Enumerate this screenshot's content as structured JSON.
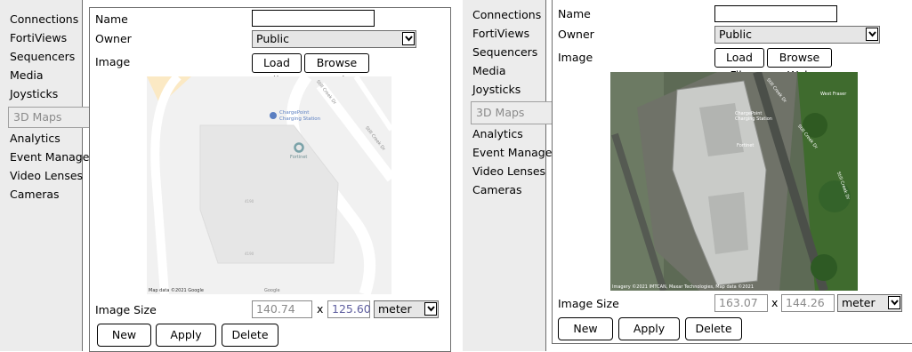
{
  "colors": {
    "sidebar_bg": "#ececec",
    "border": "#6e6e6e",
    "poi": "#5b7fc2",
    "map_bg": "#f4f4f4",
    "sat_bg": "#5f6b57"
  },
  "sidebar": {
    "items": [
      "Connections",
      "FortiViews",
      "Sequencers",
      "Media",
      "Joysticks",
      "3D Maps",
      "Analytics",
      "Event Manager",
      "Video Lenses",
      "Cameras"
    ],
    "active": "3D Maps"
  },
  "form": {
    "name_label": "Name",
    "name_value": "",
    "owner_label": "Owner",
    "owner_value": "Public",
    "image_label": "Image",
    "load_file": "Load File",
    "browse_web": "Browse Web",
    "image_size_label": "Image Size",
    "times": "x",
    "unit": "meter",
    "new": "New",
    "apply": "Apply",
    "delete": "Delete"
  },
  "left": {
    "width_value": "140.74",
    "height_value": "125.60",
    "map": {
      "poi_label_1": "ChargePoint",
      "poi_label_2": "Charging Station",
      "fortinet_label": "Fortinet",
      "road_1": "Still Creek Dr",
      "road_2": "Still Creek Dr",
      "caption": "Map data ©2021 Google",
      "logo": "Google",
      "bldg_1": "4190",
      "bldg_2": "4190"
    }
  },
  "right": {
    "width_value": "163.07",
    "height_value": "144.26",
    "map": {
      "road_1": "Still Creek Dr",
      "road_2": "Still Creek Dr",
      "road_3": "Still Creek Dr",
      "poi_label_1": "ChargePoint",
      "poi_label_2": "Charging Station",
      "fortinet_label": "Fortinet",
      "corner_label": "West Fraser",
      "caption": "Imagery ©2021 IMTCAN, Maxar Technologies, Map data ©2021"
    }
  }
}
